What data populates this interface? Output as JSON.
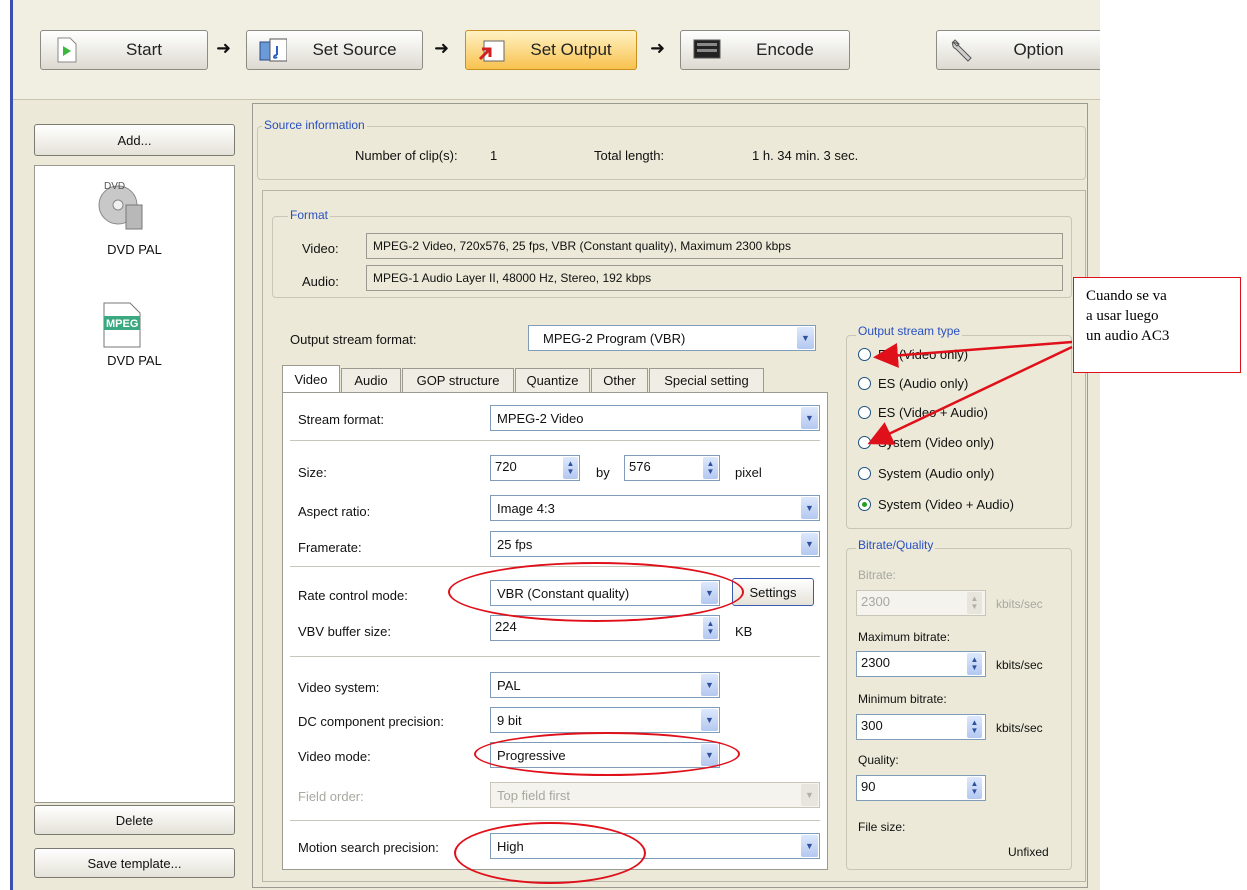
{
  "toolbar": {
    "start": "Start",
    "set_source": "Set Source",
    "set_output": "Set Output",
    "encode": "Encode",
    "option": "Option"
  },
  "left": {
    "add": "Add...",
    "items": [
      {
        "icon": "dvd-icon",
        "label": "DVD PAL"
      },
      {
        "icon": "mpeg-file-icon",
        "label": "DVD PAL"
      }
    ],
    "delete": "Delete",
    "save_template": "Save template..."
  },
  "source_info": {
    "title": "Source information",
    "clips_label": "Number of clip(s):",
    "clips_value": "1",
    "length_label": "Total length:",
    "length_value": "1 h. 34 min. 3 sec."
  },
  "format": {
    "title": "Format",
    "video_label": "Video:",
    "video_value": "MPEG-2 Video, 720x576, 25 fps, VBR (Constant quality), Maximum 2300 kbps",
    "audio_label": "Audio:",
    "audio_value": "MPEG-1 Audio Layer II, 48000 Hz, Stereo, 192 kbps"
  },
  "output_stream_format": {
    "label": "Output stream format:",
    "value": "MPEG-2 Program (VBR)"
  },
  "tabs": [
    "Video",
    "Audio",
    "GOP structure",
    "Quantize",
    "Other",
    "Special setting"
  ],
  "video": {
    "stream_format_label": "Stream format:",
    "stream_format_value": "MPEG-2 Video",
    "size_label": "Size:",
    "width": "720",
    "by": "by",
    "height": "576",
    "pixel": "pixel",
    "aspect_label": "Aspect ratio:",
    "aspect_value": "Image 4:3",
    "framerate_label": "Framerate:",
    "framerate_value": "25 fps",
    "rate_label": "Rate control mode:",
    "rate_value": "VBR (Constant quality)",
    "settings": "Settings",
    "vbv_label": "VBV buffer size:",
    "vbv_value": "224",
    "vbv_unit": "KB",
    "system_label": "Video system:",
    "system_value": "PAL",
    "dc_label": "DC component precision:",
    "dc_value": "9 bit",
    "mode_label": "Video mode:",
    "mode_value": "Progressive",
    "field_label": "Field order:",
    "field_value": "Top field first",
    "motion_label": "Motion search precision:",
    "motion_value": "High"
  },
  "stream_type": {
    "title": "Output stream type",
    "options": [
      "ES (Video only)",
      "ES (Audio only)",
      "ES (Video + Audio)",
      "System (Video only)",
      "System (Audio only)",
      "System (Video + Audio)"
    ],
    "selected": "System (Video + Audio)"
  },
  "bitrate": {
    "title": "Bitrate/Quality",
    "bitrate_label": "Bitrate:",
    "bitrate_value": "2300",
    "unit": "kbits/sec",
    "max_label": "Maximum bitrate:",
    "max_value": "2300",
    "min_label": "Minimum bitrate:",
    "min_value": "300",
    "quality_label": "Quality:",
    "quality_value": "90",
    "filesize_label": "File size:",
    "filesize_value": "Unfixed"
  },
  "annotation": {
    "line1": "Cuando se va",
    "line2": "a usar luego",
    "line3": "un audio AC3",
    "color": "#e0101a"
  }
}
